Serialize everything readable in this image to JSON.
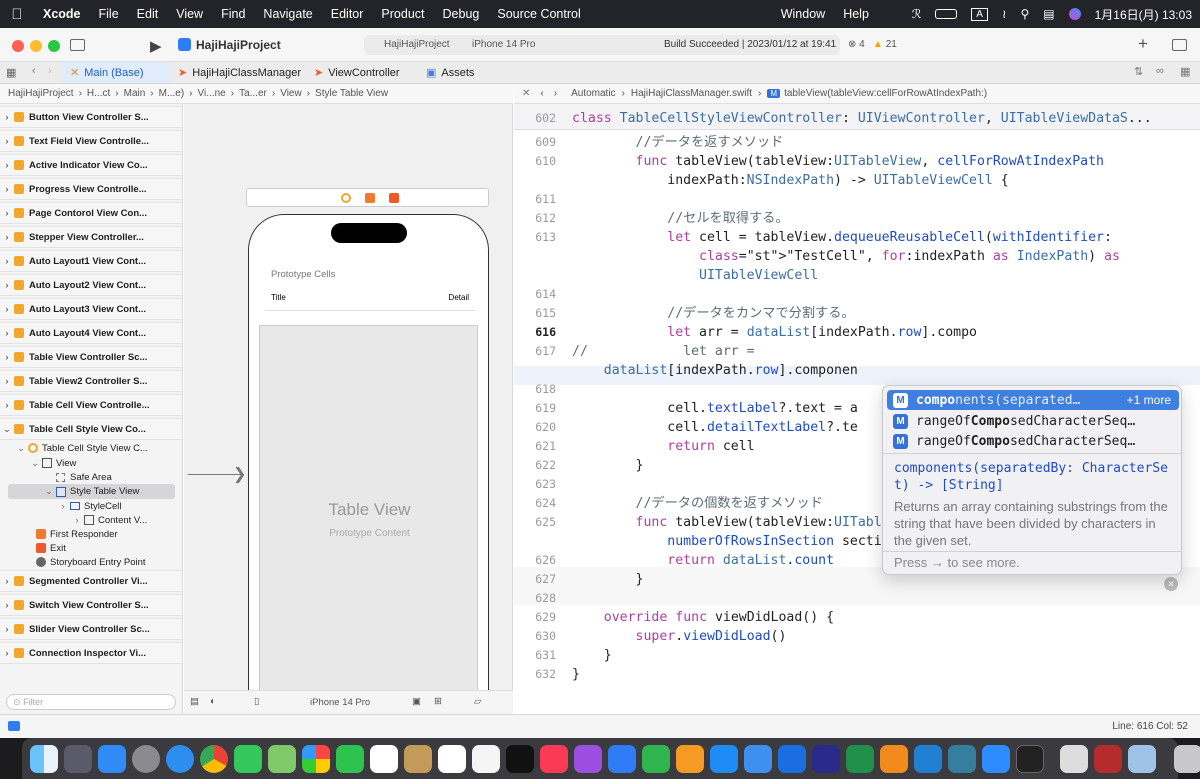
{
  "menubar": {
    "app": "Xcode",
    "items": [
      "File",
      "Edit",
      "View",
      "Find",
      "Navigate",
      "Editor",
      "Product",
      "Debug",
      "Source Control",
      "Window",
      "Help"
    ],
    "ime": "A",
    "datetime": "1月16日(月)  13:03"
  },
  "toolbar": {
    "project": "HajiHajiProject",
    "scheme": "HajiHajiProject",
    "device": "iPhone 14 Pro",
    "build_status": "Build Succeeded | 2023/01/12 at 19:41",
    "warnings": "4",
    "errors": "21",
    "add": "+"
  },
  "tabs": [
    "Main (Base)",
    "HajiHajiClassManager",
    "ViewController",
    "Assets"
  ],
  "jump_left": [
    "HajiHajiProject",
    "H...ct",
    "Main",
    "M...e)",
    "Vi...ne",
    "Ta...er",
    "View",
    "Style Table View"
  ],
  "jump_right": [
    "Automatic",
    "HajiHajiClassManager.swift",
    "tableView(tableView:cellForRowAtIndexPath:)"
  ],
  "navigator": {
    "scenes": [
      "Button View Controller S...",
      "Text Field View Controlle...",
      "Active Indicator View Co...",
      "Progress View Controlle...",
      "Page Contorol View Con...",
      "Stepper View Controller...",
      "Auto Layout1 View Cont...",
      "Auto Layout2 View Cont...",
      "Auto Layout3 View Cont...",
      "Auto Layout4 View Cont...",
      "Table View Controller Sc...",
      "Table View2 Controller S...",
      "Table Cell View Controlle...",
      "Table Cell Style View Co...",
      "Segmented Controller Vi...",
      "Switch View Controller S...",
      "Slider View Controller Sc...",
      "Connection Inspector Vi..."
    ],
    "tree": [
      "Table Cell Style View C...",
      "View",
      "Safe Area",
      "Style Table View",
      "StyleCell",
      "Content V...",
      "First Responder",
      "Exit",
      "Storyboard Entry Point"
    ],
    "filter": "Filter"
  },
  "canvas": {
    "prototype_cells": "Prototype Cells",
    "title": "Title",
    "detail": "Detail",
    "table_view": "Table View",
    "prototype_content": "Prototype Content",
    "device": "iPhone 14 Pro"
  },
  "editor": {
    "lines": [
      {
        "n": "602",
        "t": "class TableCellStyleViewController: UIViewController, UITableViewDataS..."
      },
      {
        "n": "609",
        "t": "        //データを返すメソッド"
      },
      {
        "n": "610",
        "t": "        func tableView(tableView:UITableView, cellForRowAtIndexPath"
      },
      {
        "n": "",
        "t": "            indexPath:NSIndexPath) -> UITableViewCell {"
      },
      {
        "n": "611",
        "t": ""
      },
      {
        "n": "612",
        "t": "            //セルを取得する。"
      },
      {
        "n": "613",
        "t": "            let cell = tableView.dequeueReusableCell(withIdentifier:"
      },
      {
        "n": "",
        "t": "                \"TestCell\", for:indexPath as IndexPath) as"
      },
      {
        "n": "",
        "t": "                UITableViewCell"
      },
      {
        "n": "614",
        "t": ""
      },
      {
        "n": "615",
        "t": "            //データをカンマで分割する。"
      },
      {
        "n": "616",
        "t": "            let arr = dataList[indexPath.row].compo"
      },
      {
        "n": "617",
        "t": "//            let arr ="
      },
      {
        "n": "",
        "t": "    dataList[indexPath.row].componen"
      },
      {
        "n": "618",
        "t": ""
      },
      {
        "n": "619",
        "t": "            cell.textLabel?.text = a"
      },
      {
        "n": "620",
        "t": "            cell.detailTextLabel?.te"
      },
      {
        "n": "621",
        "t": "            return cell"
      },
      {
        "n": "622",
        "t": "        }"
      },
      {
        "n": "623",
        "t": ""
      },
      {
        "n": "624",
        "t": "        //データの個数を返すメソッド"
      },
      {
        "n": "625",
        "t": "        func tableView(tableView:UITableView,"
      },
      {
        "n": "",
        "t": "            numberOfRowsInSection section:Int) -> Int {"
      },
      {
        "n": "626",
        "t": "            return dataList.count"
      },
      {
        "n": "627",
        "t": "        }"
      },
      {
        "n": "628",
        "t": ""
      },
      {
        "n": "629",
        "t": "    override func viewDidLoad() {"
      },
      {
        "n": "630",
        "t": "        super.viewDidLoad()"
      },
      {
        "n": "631",
        "t": "    }"
      },
      {
        "n": "632",
        "t": "}"
      }
    ]
  },
  "autocomplete": {
    "items": [
      {
        "pre": "compo",
        "post": "nents(separated…",
        "extra": "+1 more"
      },
      {
        "pre": "rangeOf",
        "bold": "Compo",
        "post": "sedCharacterSeq…"
      },
      {
        "pre": "rangeOf",
        "bold": "Compo",
        "post": "sedCharacterSeq…"
      }
    ],
    "signature": "components(separatedBy: CharacterSet) -> [String]",
    "description": "Returns an array containing substrings from the string that have been divided by characters in the given set.",
    "hint": "Press → to see more."
  },
  "status": {
    "position": "Line: 616  Col: 52"
  }
}
